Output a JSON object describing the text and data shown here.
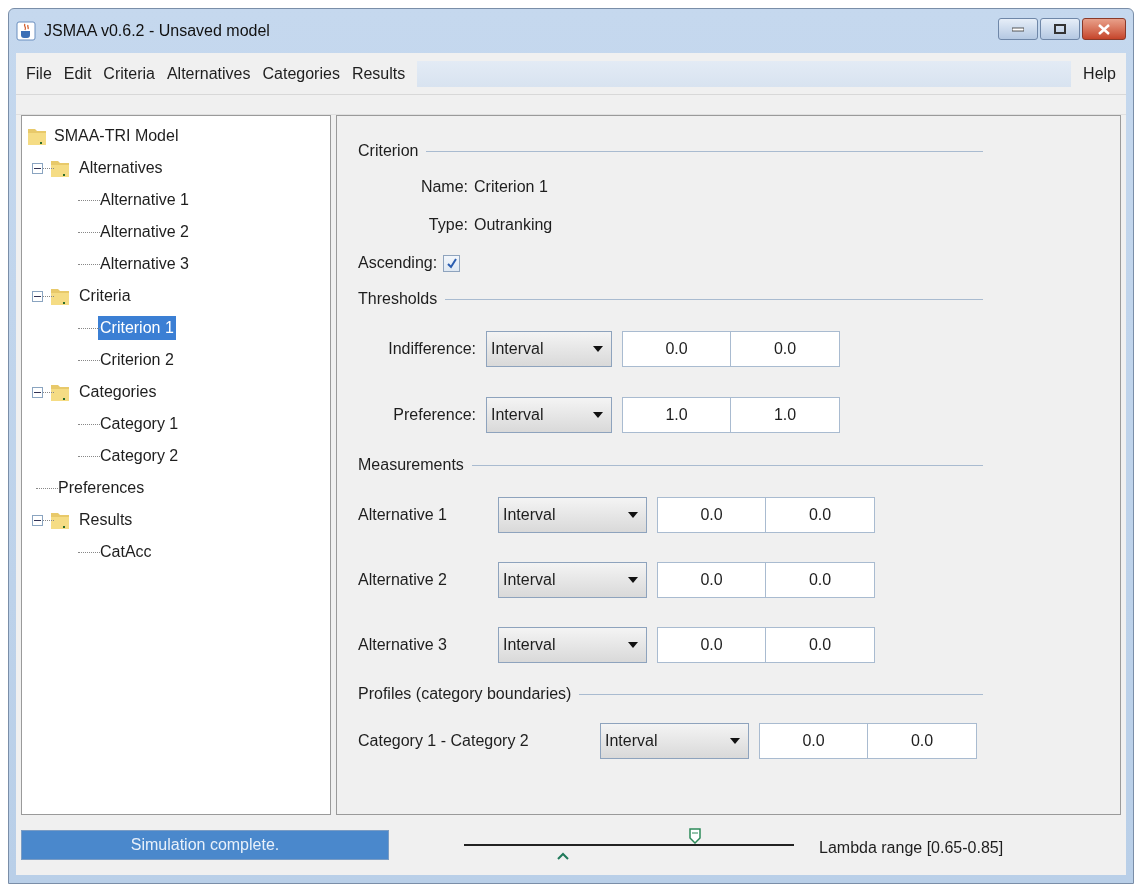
{
  "window": {
    "title": "JSMAA v0.6.2 - Unsaved model"
  },
  "menu": {
    "items": [
      "File",
      "Edit",
      "Criteria",
      "Alternatives",
      "Categories",
      "Results"
    ],
    "help": "Help"
  },
  "tree": {
    "label": "SMAA-TRI Model",
    "children": [
      {
        "label": "Alternatives",
        "kind": "folder",
        "expanded": true,
        "selected": false,
        "children": [
          {
            "label": "Alternative 1",
            "kind": "leaf",
            "selected": false
          },
          {
            "label": "Alternative 2",
            "kind": "leaf",
            "selected": false
          },
          {
            "label": "Alternative 3",
            "kind": "leaf",
            "selected": false
          }
        ]
      },
      {
        "label": "Criteria",
        "kind": "folder",
        "expanded": true,
        "selected": false,
        "children": [
          {
            "label": "Criterion 1",
            "kind": "leaf",
            "selected": true
          },
          {
            "label": "Criterion 2",
            "kind": "leaf",
            "selected": false
          }
        ]
      },
      {
        "label": "Categories",
        "kind": "folder",
        "expanded": true,
        "selected": false,
        "children": [
          {
            "label": "Category 1",
            "kind": "leaf",
            "selected": false
          },
          {
            "label": "Category 2",
            "kind": "leaf",
            "selected": false
          }
        ]
      },
      {
        "label": "Preferences",
        "kind": "leaf",
        "selected": false
      },
      {
        "label": "Results",
        "kind": "folder",
        "expanded": true,
        "selected": false,
        "children": [
          {
            "label": "CatAcc",
            "kind": "leaf",
            "selected": false
          }
        ]
      }
    ]
  },
  "sections": [
    {
      "title": "Criterion",
      "rows": [
        {
          "kind": "text",
          "label": "Name:",
          "value": "Criterion 1"
        },
        {
          "kind": "text",
          "label": "Type:",
          "value": "Outranking"
        },
        {
          "kind": "checkbox",
          "label": "Ascending:",
          "checked": true
        }
      ]
    },
    {
      "title": "Thresholds",
      "rows": [
        {
          "kind": "interval",
          "label": "Indifference:",
          "mode": "Interval",
          "low": "0.0",
          "high": "0.0"
        },
        {
          "kind": "interval",
          "label": "Preference:",
          "mode": "Interval",
          "low": "1.0",
          "high": "1.0"
        }
      ]
    },
    {
      "title": "Measurements",
      "rows": [
        {
          "kind": "interval",
          "label": "Alternative 1",
          "mode": "Interval",
          "low": "0.0",
          "high": "0.0"
        },
        {
          "kind": "interval",
          "label": "Alternative 2",
          "mode": "Interval",
          "low": "0.0",
          "high": "0.0"
        },
        {
          "kind": "interval",
          "label": "Alternative 3",
          "mode": "Interval",
          "low": "0.0",
          "high": "0.0"
        }
      ]
    },
    {
      "title": "Profiles (category boundaries)",
      "rows": [
        {
          "kind": "interval",
          "label": "Category 1 - Category 2",
          "mode": "Interval",
          "low": "0.0",
          "high": "0.0"
        }
      ]
    }
  ],
  "status_bar": {
    "progress": {
      "text": "Simulation complete."
    },
    "lambda_slider": {
      "handles": [
        {
          "level": 0.3
        },
        {
          "level": 0.7
        }
      ]
    },
    "lambda_label": "Lambda range [0.65-0.85]"
  }
}
